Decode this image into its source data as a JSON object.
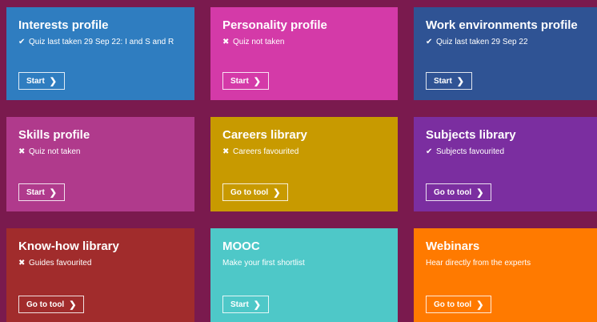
{
  "cards": [
    {
      "title": "Interests profile",
      "status_icon": "check-icon",
      "status_mark": "✔",
      "status": "Quiz last taken 29 Sep 22: I and S and R",
      "button": "Start",
      "color": "#2f7dc0"
    },
    {
      "title": "Personality profile",
      "status_icon": "cross-icon",
      "status_mark": "✖",
      "status": "Quiz not taken",
      "button": "Start",
      "color": "#d43aa8"
    },
    {
      "title": "Work environments profile",
      "status_icon": "check-icon",
      "status_mark": "✔",
      "status": "Quiz last taken 29 Sep 22",
      "button": "Start",
      "color": "#2f5394"
    },
    {
      "title": "Skills profile",
      "status_icon": "cross-icon",
      "status_mark": "✖",
      "status": "Quiz not taken",
      "button": "Start",
      "color": "#b03a8c"
    },
    {
      "title": "Careers library",
      "status_icon": "cross-icon",
      "status_mark": "✖",
      "status": "Careers favourited",
      "button": "Go to tool",
      "color": "#c89a00"
    },
    {
      "title": "Subjects library",
      "status_icon": "check-icon",
      "status_mark": "✔",
      "status": "Subjects favourited",
      "button": "Go to tool",
      "color": "#7b2ea0"
    },
    {
      "title": "Know-how library",
      "status_icon": "cross-icon",
      "status_mark": "✖",
      "status": "Guides favourited",
      "button": "Go to tool",
      "color": "#a12c2c"
    },
    {
      "title": "MOOC",
      "status_icon": "",
      "status_mark": "",
      "status": "Make your first shortlist",
      "button": "Start",
      "color": "#4ec8c8"
    },
    {
      "title": "Webinars",
      "status_icon": "",
      "status_mark": "",
      "status": "Hear directly from the experts",
      "button": "Go to tool",
      "color": "#ff7a00"
    }
  ],
  "chevron": "❯",
  "page_background": "#7a1a4e"
}
